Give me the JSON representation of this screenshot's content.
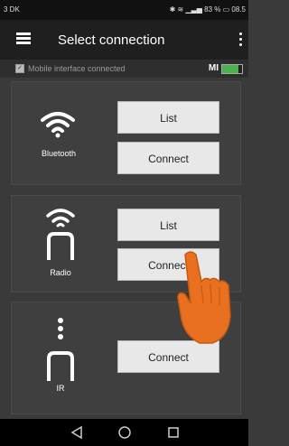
{
  "status_bar": {
    "left_text": "3 DK",
    "right_text": "83 %",
    "time": "08.5"
  },
  "app_bar": {
    "title": "Select connection",
    "menu_icon": "hamburger-menu-icon",
    "overflow_icon": "more-vert-icon"
  },
  "interface_bar": {
    "checked": true,
    "label": "Mobile interface connected",
    "badge": "MI",
    "battery_level": 0.8
  },
  "panels": [
    {
      "device": "Bluetooth",
      "icon": "bluetooth-wifi-icon",
      "buttons": [
        {
          "label": "List"
        },
        {
          "label": "Connect"
        }
      ]
    },
    {
      "device": "Radio",
      "icon": "radio-device-icon",
      "buttons": [
        {
          "label": "List"
        },
        {
          "label": "Connect"
        }
      ]
    },
    {
      "device": "IR",
      "icon": "ir-device-icon",
      "buttons": [
        {
          "label": "Connect"
        }
      ]
    }
  ],
  "colors": {
    "accent_hand": "#e8701e",
    "battery_fill": "#4caf50"
  }
}
